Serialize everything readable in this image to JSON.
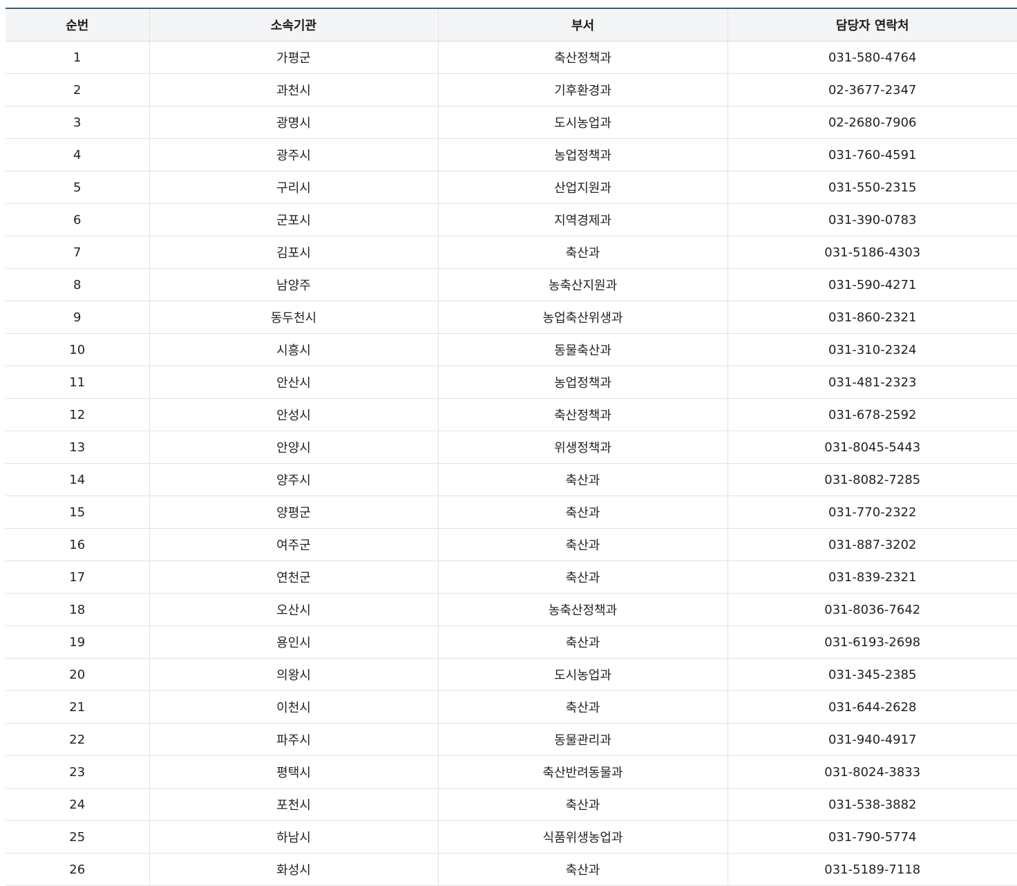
{
  "table": {
    "headers": [
      "순번",
      "소속기관",
      "부서",
      "담당자 연락처"
    ],
    "rows": [
      {
        "no": "1",
        "org": "가평군",
        "dept": "축산정책과",
        "phone": "031-580-4764"
      },
      {
        "no": "2",
        "org": "과천시",
        "dept": "기후환경과",
        "phone": "02-3677-2347"
      },
      {
        "no": "3",
        "org": "광명시",
        "dept": "도시농업과",
        "phone": "02-2680-7906"
      },
      {
        "no": "4",
        "org": "광주시",
        "dept": "농업정책과",
        "phone": "031-760-4591"
      },
      {
        "no": "5",
        "org": "구리시",
        "dept": "산업지원과",
        "phone": "031-550-2315"
      },
      {
        "no": "6",
        "org": "군포시",
        "dept": "지역경제과",
        "phone": "031-390-0783"
      },
      {
        "no": "7",
        "org": "김포시",
        "dept": "축산과",
        "phone": "031-5186-4303"
      },
      {
        "no": "8",
        "org": "남양주",
        "dept": "농축산지원과",
        "phone": "031-590-4271"
      },
      {
        "no": "9",
        "org": "동두천시",
        "dept": "농업축산위생과",
        "phone": "031-860-2321"
      },
      {
        "no": "10",
        "org": "시흥시",
        "dept": "동물축산과",
        "phone": "031-310-2324"
      },
      {
        "no": "11",
        "org": "안산시",
        "dept": "농업정책과",
        "phone": "031-481-2323"
      },
      {
        "no": "12",
        "org": "안성시",
        "dept": "축산정책과",
        "phone": "031-678-2592"
      },
      {
        "no": "13",
        "org": "안양시",
        "dept": "위생정책과",
        "phone": "031-8045-5443"
      },
      {
        "no": "14",
        "org": "양주시",
        "dept": "축산과",
        "phone": "031-8082-7285"
      },
      {
        "no": "15",
        "org": "양평군",
        "dept": "축산과",
        "phone": "031-770-2322"
      },
      {
        "no": "16",
        "org": "여주군",
        "dept": "축산과",
        "phone": "031-887-3202"
      },
      {
        "no": "17",
        "org": "연천군",
        "dept": "축산과",
        "phone": "031-839-2321"
      },
      {
        "no": "18",
        "org": "오산시",
        "dept": "농축산정책과",
        "phone": "031-8036-7642"
      },
      {
        "no": "19",
        "org": "용인시",
        "dept": "축산과",
        "phone": "031-6193-2698"
      },
      {
        "no": "20",
        "org": "의왕시",
        "dept": "도시농업과",
        "phone": "031-345-2385"
      },
      {
        "no": "21",
        "org": "이천시",
        "dept": "축산과",
        "phone": "031-644-2628"
      },
      {
        "no": "22",
        "org": "파주시",
        "dept": "동물관리과",
        "phone": "031-940-4917"
      },
      {
        "no": "23",
        "org": "평택시",
        "dept": "축산반려동물과",
        "phone": "031-8024-3833"
      },
      {
        "no": "24",
        "org": "포천시",
        "dept": "축산과",
        "phone": "031-538-3882"
      },
      {
        "no": "25",
        "org": "하남시",
        "dept": "식품위생농업과",
        "phone": "031-790-5774"
      },
      {
        "no": "26",
        "org": "화성시",
        "dept": "축산과",
        "phone": "031-5189-7118"
      }
    ]
  }
}
